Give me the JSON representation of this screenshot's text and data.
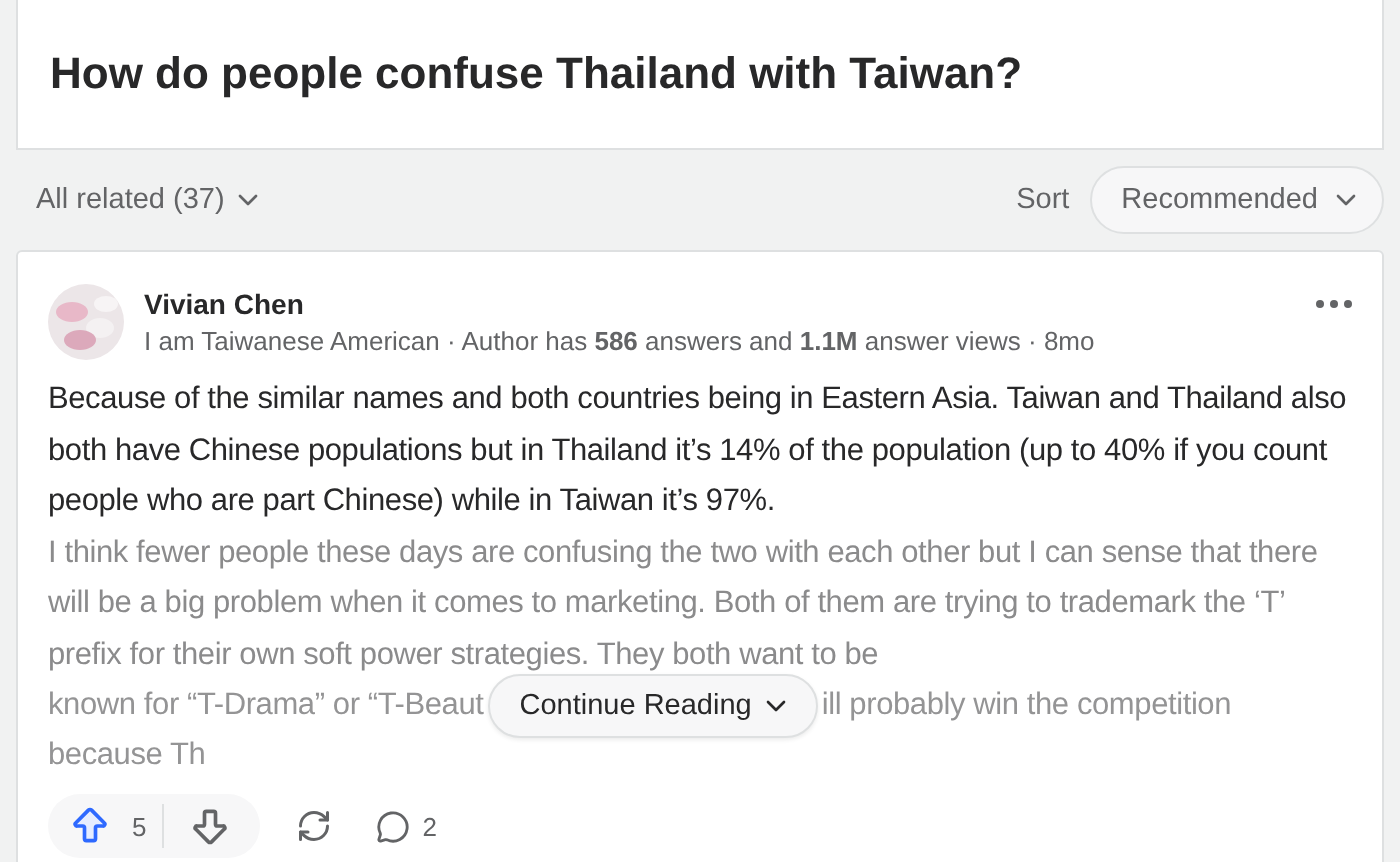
{
  "question": {
    "title": "How do people confuse Thailand with Taiwan?"
  },
  "filter": {
    "label": "All related (37)",
    "sort_label": "Sort",
    "sort_value": "Recommended"
  },
  "answer": {
    "author": "Vivian Chen",
    "credential": "I am Taiwanese American · Author has **586** answers and **1.1M** answer views · 8mo",
    "paragraphs": [
      "Because of the similar names and both countries being in Eastern Asia. Taiwan and Thailand also both have Chinese populations but in Thailand it’s 14% of the population (up to 40% if you count people who are part Chinese) while in Taiwan it’s 97%.",
      "I think fewer people these days are confusing the two with each other but I can sense that there will be a big problem when it comes to marketing. Both of them are trying to trademark the ‘T’ prefix for their own soft power strategies. They both want to be"
    ],
    "faded_left": "known for “T-Drama” or “T-Beaut",
    "faded_right": "ill probably win the competition",
    "faded_last": "because Th",
    "continue": "Continue Reading",
    "upvotes": "5",
    "upvoted": true,
    "comments": "2"
  }
}
